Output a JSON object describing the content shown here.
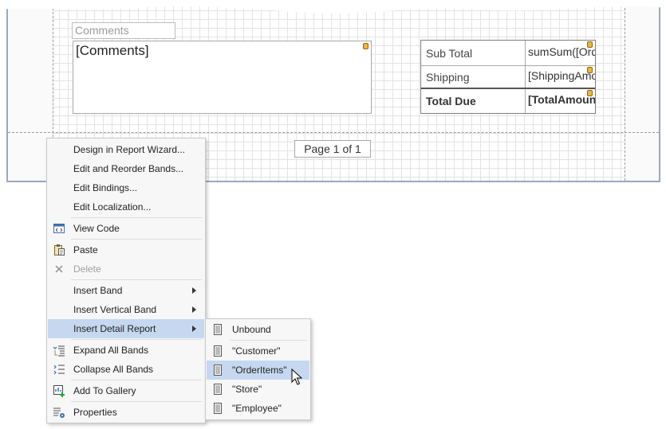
{
  "designer": {
    "comments_caption": "Comments",
    "comments_field": "[Comments]",
    "totals": [
      {
        "label": "Sub Total",
        "value": "sumSum([Ord"
      },
      {
        "label": "Shipping",
        "value": "[ShippingAmo"
      },
      {
        "label": "Total Due",
        "value": "[TotalAmount"
      }
    ],
    "page_info": "Page 1 of 1"
  },
  "context_menu": {
    "items": [
      {
        "label": "Design in Report Wizard...",
        "icon": "none"
      },
      {
        "label": "Edit and Reorder Bands...",
        "icon": "none"
      },
      {
        "label": "Edit Bindings...",
        "icon": "none"
      },
      {
        "label": "Edit Localization...",
        "icon": "none"
      },
      {
        "label": "View Code",
        "icon": "view-code-icon"
      },
      {
        "label": "Paste",
        "icon": "paste-icon"
      },
      {
        "label": "Delete",
        "icon": "delete-icon"
      },
      {
        "label": "Insert Band",
        "icon": "none"
      },
      {
        "label": "Insert Vertical Band",
        "icon": "none"
      },
      {
        "label": "Insert Detail Report",
        "icon": "none"
      },
      {
        "label": "Expand All Bands",
        "icon": "expand-all-icon"
      },
      {
        "label": "Collapse All Bands",
        "icon": "collapse-all-icon"
      },
      {
        "label": "Add To Gallery",
        "icon": "add-to-gallery-icon"
      },
      {
        "label": "Properties",
        "icon": "properties-icon"
      }
    ],
    "disabled_item": "Delete",
    "highlighted_item": "Insert Detail Report"
  },
  "submenu": {
    "items": [
      {
        "label": "Unbound"
      },
      {
        "label": "\"Customer\""
      },
      {
        "label": "\"OrderItems\""
      },
      {
        "label": "\"Store\""
      },
      {
        "label": "\"Employee\""
      }
    ],
    "highlighted_item": "\"OrderItems\""
  },
  "colors": {
    "highlight": "#c6d8f0",
    "designer_border": "#9aa7c3",
    "field_tag": "#f2b531"
  }
}
